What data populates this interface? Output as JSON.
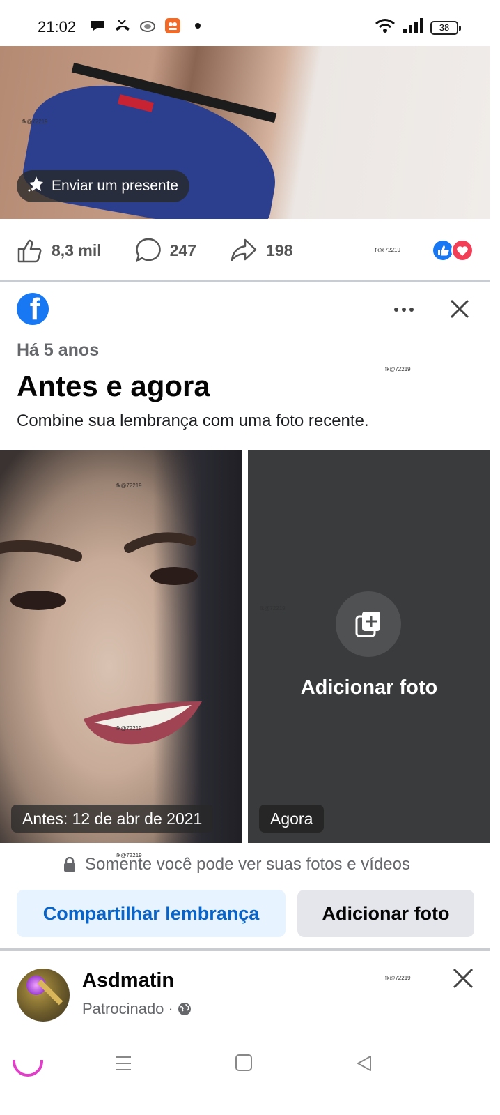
{
  "status_bar": {
    "time": "21:02",
    "battery": "38"
  },
  "top_post": {
    "gift_label": "Enviar um presente",
    "likes": "8,3 mil",
    "comments": "247",
    "shares": "198",
    "watermark": "fk@72219"
  },
  "memory": {
    "subtitle": "Há 5 anos",
    "title": "Antes e agora",
    "description": "Combine sua lembrança com uma foto recente.",
    "before_label": "Antes: 12 de abr de 2021",
    "add_photo_label": "Adicionar foto",
    "after_label": "Agora",
    "privacy_text": "Somente você pode ver suas fotos e vídeos",
    "share_button": "Compartilhar lembrança",
    "add_button": "Adicionar foto",
    "watermark": "fk@72219"
  },
  "sponsored": {
    "name": "Asdmatin",
    "label": "Patrocinado",
    "separator": "·",
    "watermark": "fk@72219"
  },
  "colors": {
    "facebook_blue": "#1877f2",
    "share_button_bg": "#e7f3ff",
    "share_button_text": "#0a64c8",
    "secondary_button_bg": "#e4e6eb",
    "dark_panel": "#3a3b3c"
  }
}
